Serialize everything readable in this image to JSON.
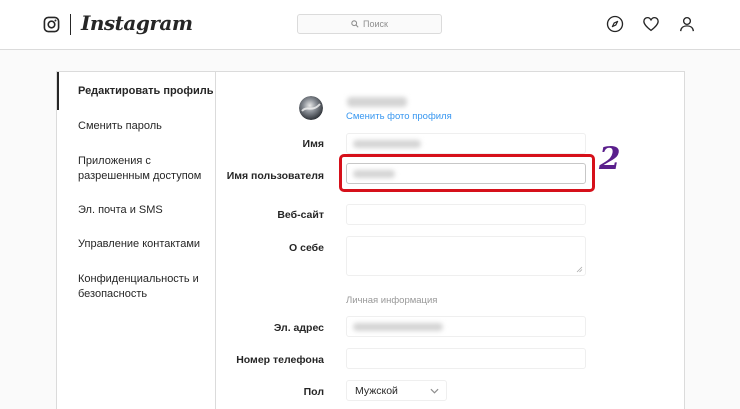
{
  "header": {
    "logo_text": "Instagram",
    "search_placeholder": "Поиск",
    "icons": [
      "instagram-camera-icon",
      "search-icon",
      "compass-icon",
      "heart-icon",
      "profile-icon"
    ]
  },
  "sidebar": {
    "items": [
      {
        "label": "Редактировать профиль",
        "active": true
      },
      {
        "label": "Сменить пароль"
      },
      {
        "label": "Приложения с разрешенным доступом"
      },
      {
        "label": "Эл. почта и SMS"
      },
      {
        "label": "Управление контактами"
      },
      {
        "label": "Конфиденциальность и безопасность"
      }
    ]
  },
  "profile": {
    "change_photo_label": "Сменить фото профиля",
    "fields": {
      "name": "Имя",
      "username": "Имя пользователя",
      "website": "Веб-сайт",
      "bio": "О себе",
      "email": "Эл. адрес",
      "phone": "Номер телефона",
      "gender": "Пол"
    },
    "personal_info_title": "Личная информация",
    "gender_value": "Мужской"
  },
  "annotation": {
    "number": "2",
    "highlight_color": "#d6101a",
    "number_color": "#5a1f8c"
  },
  "colors": {
    "link": "#3897f0",
    "border": "#dbdbdb",
    "background": "#fafafa"
  }
}
